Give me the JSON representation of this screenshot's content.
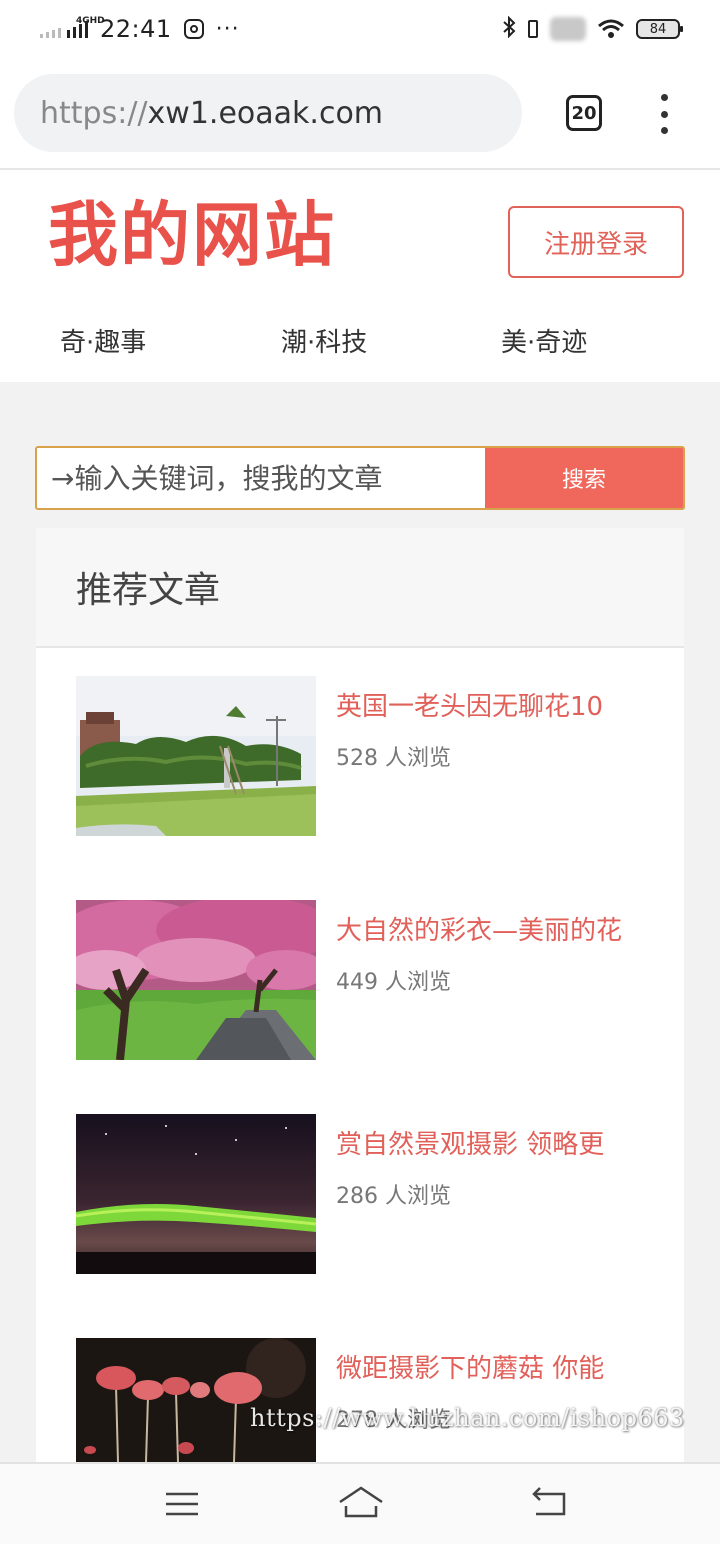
{
  "status_bar": {
    "network": "4GHD",
    "time": "22:41",
    "more": "···",
    "battery": "84"
  },
  "browser": {
    "url_scheme": "https://",
    "url_host": "xw1.eoaak.com",
    "tab_count": "20"
  },
  "site": {
    "logo": "我的网站",
    "login_label": "注册登录",
    "nav": [
      "奇·趣事",
      "潮·科技",
      "美·奇迹"
    ]
  },
  "search": {
    "placeholder": "→输入关键词，搜我的文章",
    "button": "搜索"
  },
  "recommend": {
    "title": "推荐文章",
    "articles": [
      {
        "title": "英国一老头因无聊花10",
        "views": "528 人浏览",
        "image": "hedge-topiary-photo"
      },
      {
        "title": "大自然的彩衣—美丽的花",
        "views": "449 人浏览",
        "image": "cherry-blossom-path-photo"
      },
      {
        "title": "赏自然景观摄影 领略更",
        "views": "286 人浏览",
        "image": "aurora-night-photo"
      },
      {
        "title": "微距摄影下的蘑菇 你能",
        "views": "278 人浏览",
        "image": "red-mushrooms-photo"
      }
    ]
  },
  "watermark": "https://www.huzhan.com/ishop663",
  "icons": [
    "signal-icon",
    "bluetooth-icon",
    "vibrate-icon",
    "wifi-icon",
    "battery-icon",
    "more-vert-icon",
    "menu-icon",
    "home-icon",
    "back-icon"
  ],
  "colors": {
    "brand": "#e8524a",
    "search_border": "#d8a14a",
    "search_button": "#f0675c",
    "article_title": "#e2605a"
  }
}
